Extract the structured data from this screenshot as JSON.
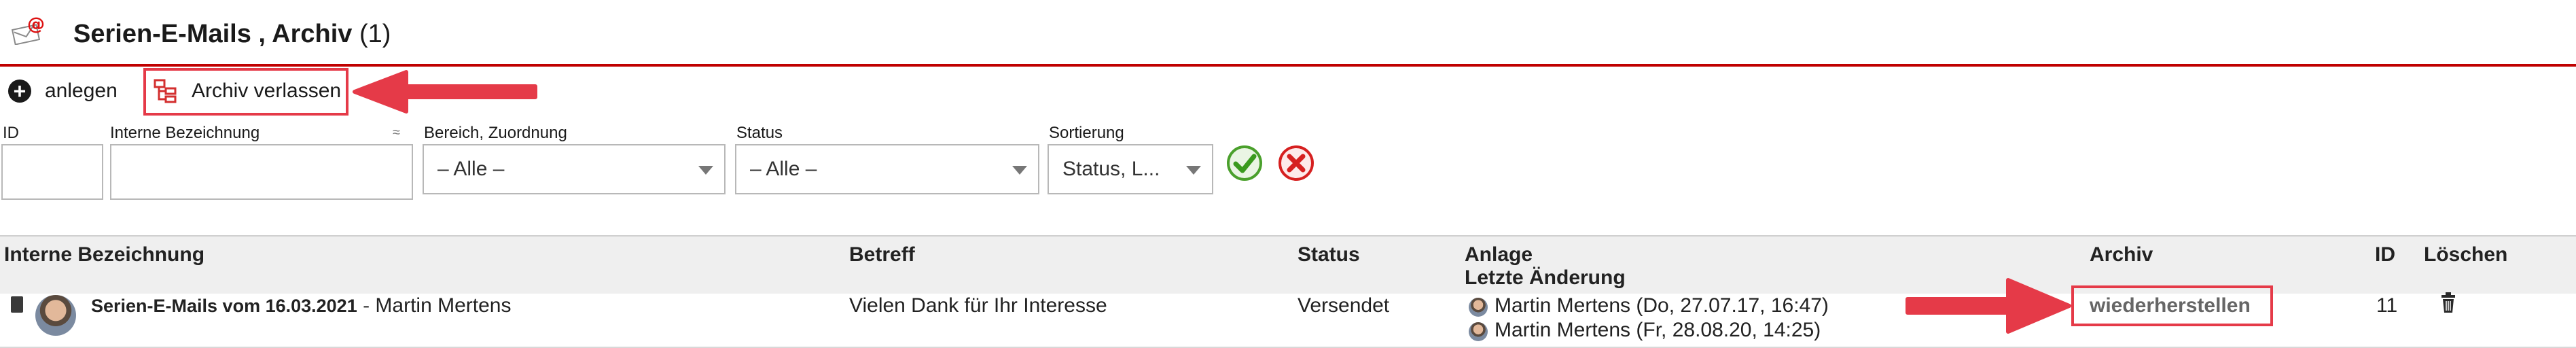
{
  "header": {
    "icon": "at-email-icon",
    "title": "Serien-E-Mails , Archiv",
    "count": "(1)",
    "accent_color": "#c00000"
  },
  "toolbar": {
    "new_label": "anlegen",
    "leave_archive_label": "Archiv verlassen"
  },
  "filter": {
    "id_label": "ID",
    "internal_label": "Interne Bezeichnung",
    "approx_symbol": "≈",
    "area_label": "Bereich, Zuordnung",
    "area_value": "– Alle –",
    "status_label": "Status",
    "status_value": "– Alle –",
    "sort_label": "Sortierung",
    "sort_value": "Status, L..."
  },
  "table": {
    "columns": {
      "internal": "Interne Bezeichnung",
      "subject": "Betreff",
      "status": "Status",
      "created": "Anlage",
      "modified": "Letzte Änderung",
      "archive": "Archiv",
      "id": "ID",
      "delete": "Löschen"
    },
    "rows": [
      {
        "name": "Serien-E-Mails vom 16.03.2021",
        "separator": "-",
        "author": "Martin Mertens",
        "subject": "Vielen Dank für Ihr Interesse",
        "status": "Versendet",
        "created": "Martin Mertens (Do, 27.07.17, 16:47)",
        "modified": "Martin Mertens (Fr, 28.08.20, 14:25)",
        "archive_action": "wiederherstellen",
        "id": "11"
      }
    ]
  },
  "annotations": {
    "highlight_color": "#e53a48"
  }
}
